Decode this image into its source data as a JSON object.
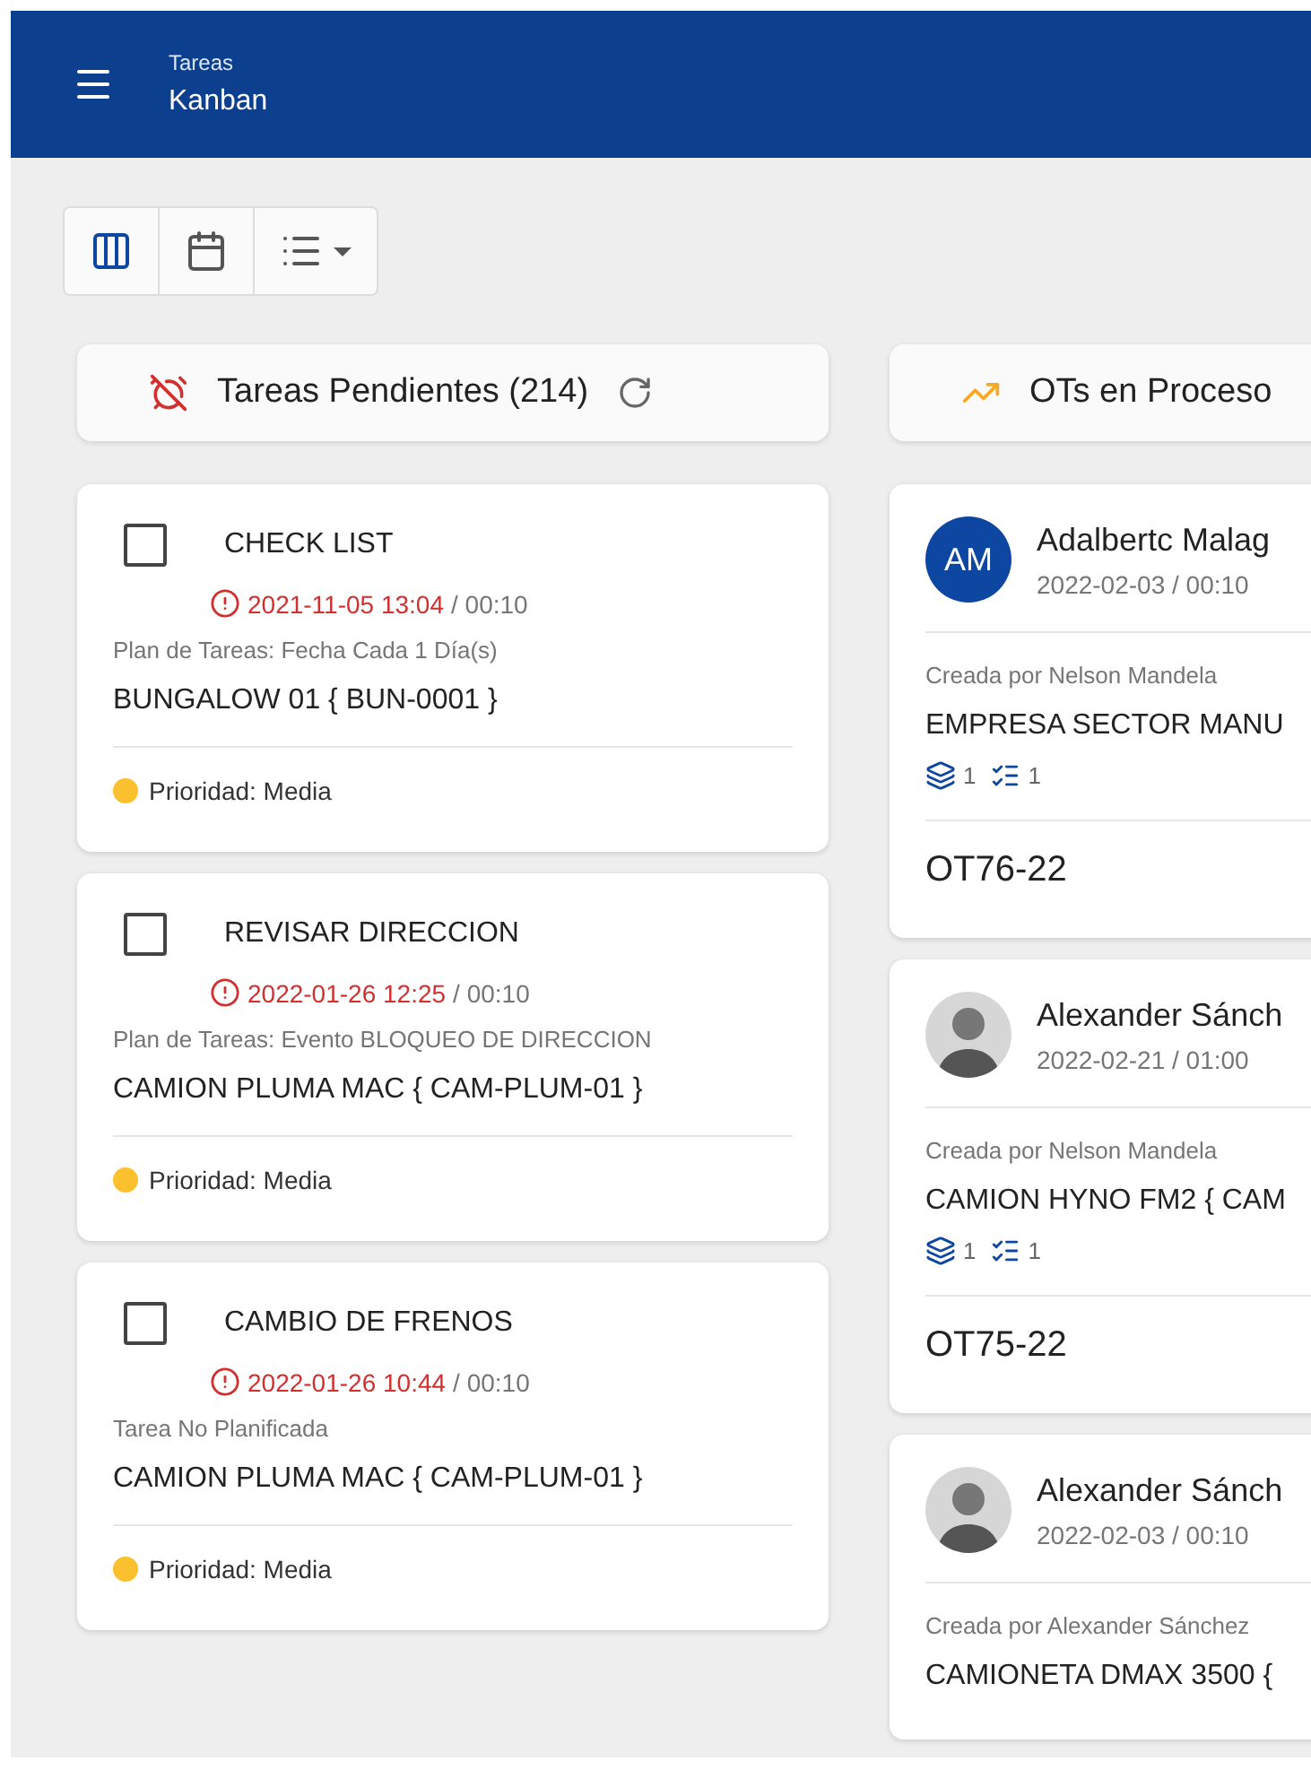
{
  "header": {
    "title": "Tareas",
    "subtitle": "Kanban"
  },
  "view_switcher": [
    {
      "kind": "board",
      "selected": true
    },
    {
      "kind": "calendar",
      "selected": false
    },
    {
      "kind": "list",
      "selected": false
    }
  ],
  "columns": [
    {
      "kind": "tasks",
      "title": "Tareas Pendientes (214)",
      "cards": [
        {
          "title": "CHECK LIST",
          "checked": false,
          "due": "2021-11-05 13:04",
          "duration": "/ 00:10",
          "plan": "Plan de Tareas: Fecha Cada 1 Día(s)",
          "asset": "BUNGALOW 01 { BUN-0001 }",
          "priority": "Prioridad: Media",
          "color": "#fbc02d"
        },
        {
          "title": "REVISAR DIRECCION",
          "checked": false,
          "due": "2022-01-26 12:25",
          "duration": "/ 00:10",
          "plan": "Plan de Tareas: Evento BLOQUEO DE DIRECCION",
          "asset": "CAMION PLUMA MAC { CAM-PLUM-01 }",
          "priority": "Prioridad: Media",
          "color": "#fbc02d"
        },
        {
          "title": "CAMBIO DE FRENOS",
          "checked": false,
          "due": "2022-01-26 10:44",
          "duration": "/ 00:10",
          "plan": "Tarea No Planificada",
          "asset": "CAMION PLUMA MAC { CAM-PLUM-01 }",
          "priority": "Prioridad: Media",
          "color": "#fbc02d"
        }
      ]
    },
    {
      "kind": "orders",
      "title": "OTs en Proceso",
      "cards": [
        {
          "avatar": {
            "kind": "initials",
            "initials": "AM"
          },
          "name": "Adalbertc Malag",
          "date": "2022-02-03 / 00:10",
          "creator": "Creada por Nelson Mandela",
          "asset": "EMPRESA SECTOR MANU",
          "parts": "1",
          "tasks": "1",
          "code": "OT76-22"
        },
        {
          "avatar": {
            "kind": "photo"
          },
          "name": "Alexander Sánch",
          "date": "2022-02-21 / 01:00",
          "creator": "Creada por Nelson Mandela",
          "asset": "CAMION HYNO FM2 { CAM",
          "parts": "1",
          "tasks": "1",
          "code": "OT75-22"
        },
        {
          "avatar": {
            "kind": "photo"
          },
          "name": "Alexander Sánch",
          "date": "2022-02-03 / 00:10",
          "creator": "Creada por Alexander Sánchez",
          "asset": "CAMIONETA DMAX 3500 {"
        }
      ]
    }
  ]
}
